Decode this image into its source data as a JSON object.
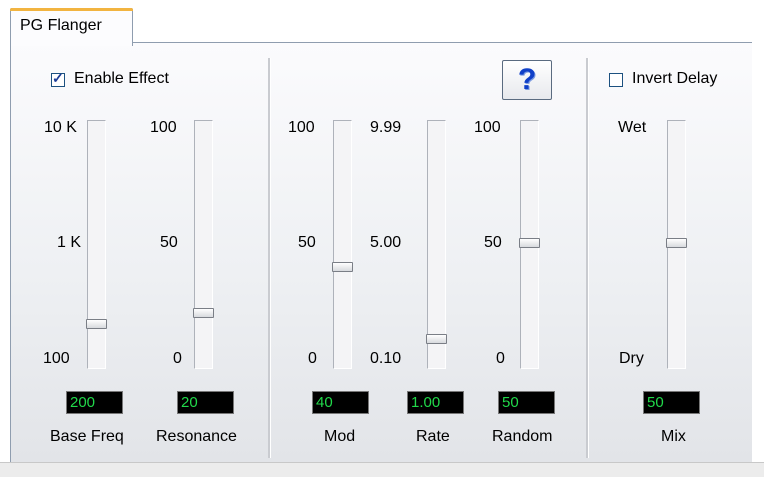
{
  "tab": {
    "label": "PG Flanger"
  },
  "enable_effect": {
    "label": "Enable Effect",
    "checked": true
  },
  "invert_delay": {
    "label": "Invert Delay",
    "checked": false
  },
  "help_button": {
    "label": "?"
  },
  "sliders": {
    "base_freq": {
      "label": "Base Freq",
      "value": "200",
      "ticks": [
        "10 K",
        "1 K",
        "100"
      ]
    },
    "resonance": {
      "label": "Resonance",
      "value": "20",
      "ticks": [
        "100",
        "50",
        "0"
      ]
    },
    "mod": {
      "label": "Mod",
      "value": "40",
      "ticks": [
        "100",
        "50",
        "0"
      ]
    },
    "rate": {
      "label": "Rate",
      "value": "1.00",
      "ticks": [
        "9.99",
        "5.00",
        "0.10"
      ]
    },
    "random": {
      "label": "Random",
      "value": "50",
      "ticks": [
        "100",
        "50",
        "0"
      ]
    },
    "mix": {
      "label": "Mix",
      "value": "50",
      "ticks": [
        "Wet",
        "Dry"
      ]
    }
  },
  "colors": {
    "lcd_background": "#000000",
    "lcd_text": "#21d94a",
    "tab_accent": "#f2b440",
    "help_icon": "#1040c8"
  }
}
